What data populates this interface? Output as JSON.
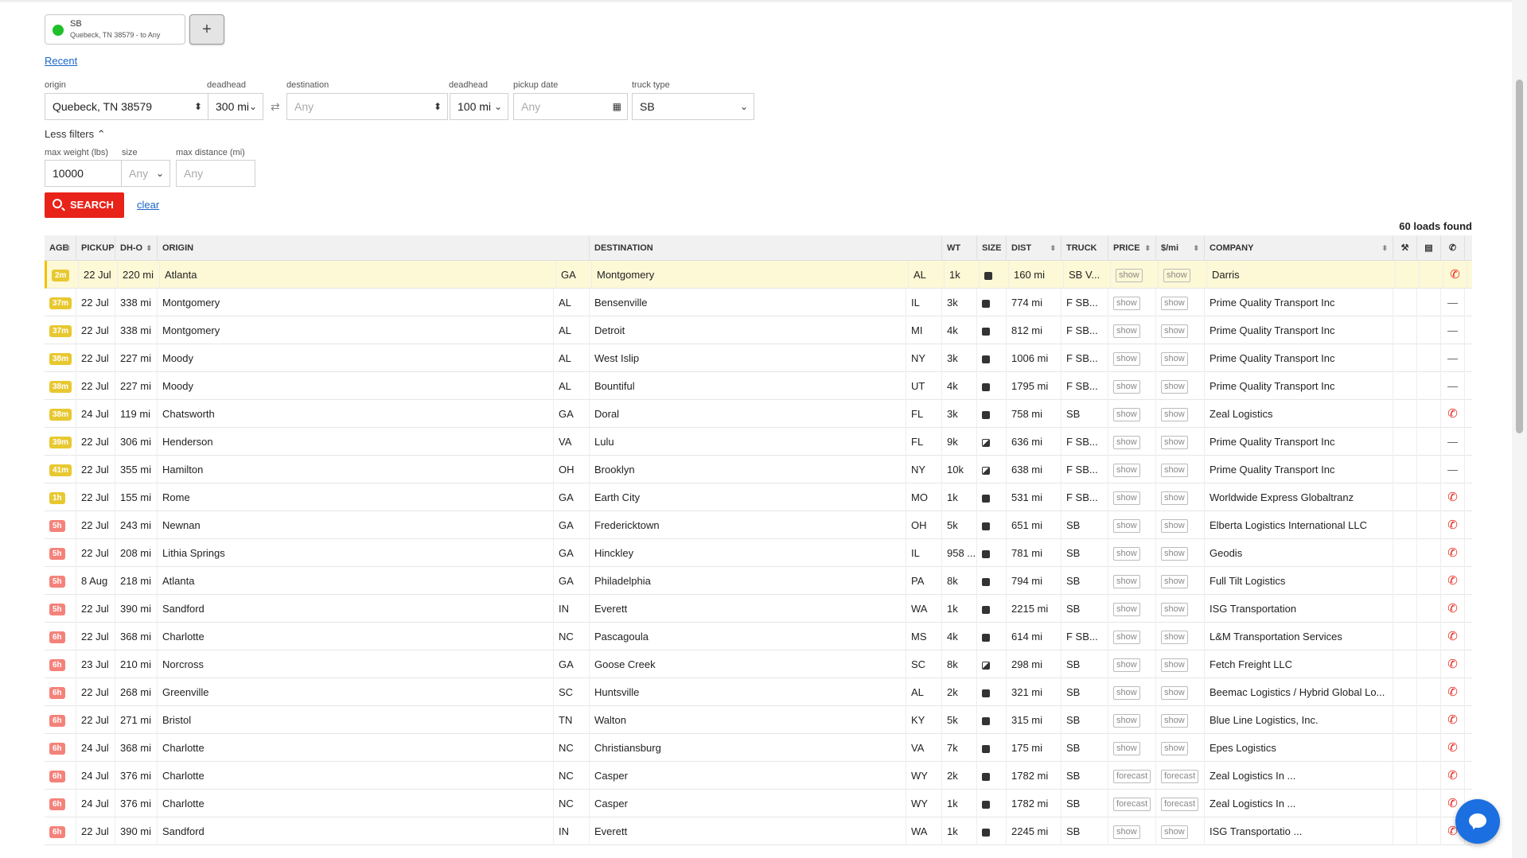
{
  "saved_search": {
    "title": "SB",
    "subtitle": "Quebeck, TN 38579 - to Any",
    "status_color": "#1fc02a"
  },
  "add_label": "+",
  "recent_label": "Recent",
  "filters": {
    "origin_label": "origin",
    "origin_value": "Quebeck, TN 38579",
    "deadhead1_label": "deadhead",
    "deadhead1_value": "300 mi",
    "destination_label": "destination",
    "destination_placeholder": "Any",
    "deadhead2_label": "deadhead",
    "deadhead2_value": "100 mi",
    "pickup_label": "pickup date",
    "pickup_placeholder": "Any",
    "truck_label": "truck type",
    "truck_value": "SB",
    "less_filters": "Less filters",
    "weight_label": "max weight (lbs)",
    "weight_value": "10000",
    "size_label": "size",
    "size_value": "Any",
    "maxdist_label": "max distance (mi)",
    "maxdist_placeholder": "Any"
  },
  "search_label": "SEARCH",
  "clear_label": "clear",
  "found_label": "60 loads found",
  "columns": [
    "AGE",
    "PICKUP",
    "DH-O",
    "ORIGIN",
    "",
    "DESTINATION",
    "",
    "WT",
    "SIZE",
    "DIST",
    "TRUCK",
    "PRICE",
    "$/mi",
    "COMPANY"
  ],
  "rows": [
    {
      "age": "2m",
      "ac": "yellow",
      "pickup": "22 Jul",
      "dho": "220 mi",
      "origin": "Atlanta",
      "ost": "GA",
      "dest": "Montgomery",
      "dst": "AL",
      "wt": "1k",
      "size": "full",
      "dist": "160 mi",
      "truck": "SB V...",
      "price": "show",
      "ppm": "show",
      "company": "Darris",
      "contact": "phone"
    },
    {
      "age": "37m",
      "ac": "yellow",
      "pickup": "22 Jul",
      "dho": "338 mi",
      "origin": "Montgomery",
      "ost": "AL",
      "dest": "Bensenville",
      "dst": "IL",
      "wt": "3k",
      "size": "full",
      "dist": "774 mi",
      "truck": "F SB...",
      "price": "show",
      "ppm": "show",
      "company": "Prime Quality Transport Inc",
      "contact": "dash"
    },
    {
      "age": "37m",
      "ac": "yellow",
      "pickup": "22 Jul",
      "dho": "338 mi",
      "origin": "Montgomery",
      "ost": "AL",
      "dest": "Detroit",
      "dst": "MI",
      "wt": "4k",
      "size": "full",
      "dist": "812 mi",
      "truck": "F SB...",
      "price": "show",
      "ppm": "show",
      "company": "Prime Quality Transport Inc",
      "contact": "dash"
    },
    {
      "age": "38m",
      "ac": "yellow",
      "pickup": "22 Jul",
      "dho": "227 mi",
      "origin": "Moody",
      "ost": "AL",
      "dest": "West Islip",
      "dst": "NY",
      "wt": "3k",
      "size": "full",
      "dist": "1006 mi",
      "truck": "F SB...",
      "price": "show",
      "ppm": "show",
      "company": "Prime Quality Transport Inc",
      "contact": "dash"
    },
    {
      "age": "38m",
      "ac": "yellow",
      "pickup": "22 Jul",
      "dho": "227 mi",
      "origin": "Moody",
      "ost": "AL",
      "dest": "Bountiful",
      "dst": "UT",
      "wt": "4k",
      "size": "full",
      "dist": "1795 mi",
      "truck": "F SB...",
      "price": "show",
      "ppm": "show",
      "company": "Prime Quality Transport Inc",
      "contact": "dash"
    },
    {
      "age": "38m",
      "ac": "yellow",
      "pickup": "24 Jul",
      "dho": "119 mi",
      "origin": "Chatsworth",
      "ost": "GA",
      "dest": "Doral",
      "dst": "FL",
      "wt": "3k",
      "size": "full",
      "dist": "758 mi",
      "truck": "SB",
      "price": "show",
      "ppm": "show",
      "company": "Zeal Logistics",
      "contact": "phone"
    },
    {
      "age": "39m",
      "ac": "yellow",
      "pickup": "22 Jul",
      "dho": "306 mi",
      "origin": "Henderson",
      "ost": "VA",
      "dest": "Lulu",
      "dst": "FL",
      "wt": "9k",
      "size": "partial",
      "dist": "636 mi",
      "truck": "F SB...",
      "price": "show",
      "ppm": "show",
      "company": "Prime Quality Transport Inc",
      "contact": "dash"
    },
    {
      "age": "41m",
      "ac": "yellow",
      "pickup": "22 Jul",
      "dho": "355 mi",
      "origin": "Hamilton",
      "ost": "OH",
      "dest": "Brooklyn",
      "dst": "NY",
      "wt": "10k",
      "size": "partial",
      "dist": "638 mi",
      "truck": "F SB...",
      "price": "show",
      "ppm": "show",
      "company": "Prime Quality Transport Inc",
      "contact": "dash"
    },
    {
      "age": "1h",
      "ac": "yellow",
      "pickup": "22 Jul",
      "dho": "155 mi",
      "origin": "Rome",
      "ost": "GA",
      "dest": "Earth City",
      "dst": "MO",
      "wt": "1k",
      "size": "full",
      "dist": "531 mi",
      "truck": "F SB...",
      "price": "show",
      "ppm": "show",
      "company": "Worldwide Express Globaltranz",
      "contact": "phone"
    },
    {
      "age": "5h",
      "ac": "red",
      "pickup": "22 Jul",
      "dho": "243 mi",
      "origin": "Newnan",
      "ost": "GA",
      "dest": "Fredericktown",
      "dst": "OH",
      "wt": "5k",
      "size": "full",
      "dist": "651 mi",
      "truck": "SB",
      "price": "show",
      "ppm": "show",
      "company": "Elberta Logistics International LLC",
      "contact": "phone"
    },
    {
      "age": "5h",
      "ac": "red",
      "pickup": "22 Jul",
      "dho": "208 mi",
      "origin": "Lithia Springs",
      "ost": "GA",
      "dest": "Hinckley",
      "dst": "IL",
      "wt": "958 ...",
      "size": "full",
      "dist": "781 mi",
      "truck": "SB",
      "price": "show",
      "ppm": "show",
      "company": "Geodis",
      "contact": "phone"
    },
    {
      "age": "5h",
      "ac": "red",
      "pickup": "8 Aug",
      "dho": "218 mi",
      "origin": "Atlanta",
      "ost": "GA",
      "dest": "Philadelphia",
      "dst": "PA",
      "wt": "8k",
      "size": "full",
      "dist": "794 mi",
      "truck": "SB",
      "price": "show",
      "ppm": "show",
      "company": "Full Tilt Logistics",
      "contact": "phone"
    },
    {
      "age": "5h",
      "ac": "red",
      "pickup": "22 Jul",
      "dho": "390 mi",
      "origin": "Sandford",
      "ost": "IN",
      "dest": "Everett",
      "dst": "WA",
      "wt": "1k",
      "size": "full",
      "dist": "2215 mi",
      "truck": "SB",
      "price": "show",
      "ppm": "show",
      "company": "ISG Transportation",
      "contact": "phone"
    },
    {
      "age": "6h",
      "ac": "red",
      "pickup": "22 Jul",
      "dho": "368 mi",
      "origin": "Charlotte",
      "ost": "NC",
      "dest": "Pascagoula",
      "dst": "MS",
      "wt": "4k",
      "size": "full",
      "dist": "614 mi",
      "truck": "F SB...",
      "price": "show",
      "ppm": "show",
      "company": "L&M Transportation Services",
      "contact": "phone"
    },
    {
      "age": "6h",
      "ac": "red",
      "pickup": "23 Jul",
      "dho": "210 mi",
      "origin": "Norcross",
      "ost": "GA",
      "dest": "Goose Creek",
      "dst": "SC",
      "wt": "8k",
      "size": "partial",
      "dist": "298 mi",
      "truck": "SB",
      "price": "show",
      "ppm": "show",
      "company": "Fetch Freight LLC",
      "contact": "phone"
    },
    {
      "age": "6h",
      "ac": "red",
      "pickup": "22 Jul",
      "dho": "268 mi",
      "origin": "Greenville",
      "ost": "SC",
      "dest": "Huntsville",
      "dst": "AL",
      "wt": "2k",
      "size": "full",
      "dist": "321 mi",
      "truck": "SB",
      "price": "show",
      "ppm": "show",
      "company": "Beemac Logistics / Hybrid Global Lo...",
      "contact": "phone"
    },
    {
      "age": "6h",
      "ac": "red",
      "pickup": "22 Jul",
      "dho": "271 mi",
      "origin": "Bristol",
      "ost": "TN",
      "dest": "Walton",
      "dst": "KY",
      "wt": "5k",
      "size": "full",
      "dist": "315 mi",
      "truck": "SB",
      "price": "show",
      "ppm": "show",
      "company": "Blue Line Logistics, Inc.",
      "contact": "phone"
    },
    {
      "age": "6h",
      "ac": "red",
      "pickup": "24 Jul",
      "dho": "368 mi",
      "origin": "Charlotte",
      "ost": "NC",
      "dest": "Christiansburg",
      "dst": "VA",
      "wt": "7k",
      "size": "full",
      "dist": "175 mi",
      "truck": "SB",
      "price": "show",
      "ppm": "show",
      "company": "Epes Logistics",
      "contact": "phone"
    },
    {
      "age": "6h",
      "ac": "red",
      "pickup": "24 Jul",
      "dho": "376 mi",
      "origin": "Charlotte",
      "ost": "NC",
      "dest": "Casper",
      "dst": "WY",
      "wt": "2k",
      "size": "full",
      "dist": "1782 mi",
      "truck": "SB",
      "price": "forecast",
      "ppm": "forecast",
      "company": "Zeal Logistics In ...",
      "contact": "phone"
    },
    {
      "age": "6h",
      "ac": "red",
      "pickup": "24 Jul",
      "dho": "376 mi",
      "origin": "Charlotte",
      "ost": "NC",
      "dest": "Casper",
      "dst": "WY",
      "wt": "1k",
      "size": "full",
      "dist": "1782 mi",
      "truck": "SB",
      "price": "forecast",
      "ppm": "forecast",
      "company": "Zeal Logistics In ...",
      "contact": "phone"
    },
    {
      "age": "6h",
      "ac": "red",
      "pickup": "22 Jul",
      "dho": "390 mi",
      "origin": "Sandford",
      "ost": "IN",
      "dest": "Everett",
      "dst": "WA",
      "wt": "1k",
      "size": "full",
      "dist": "2245 mi",
      "truck": "SB",
      "price": "show",
      "ppm": "show",
      "company": "ISG Transportatio ...",
      "contact": "phone"
    }
  ],
  "colors": {
    "accent": "#e8231a",
    "link": "#1a66c8",
    "badge_recent": "#e8c830",
    "badge_old": "#f4827a",
    "chat": "#1b6fe0"
  }
}
